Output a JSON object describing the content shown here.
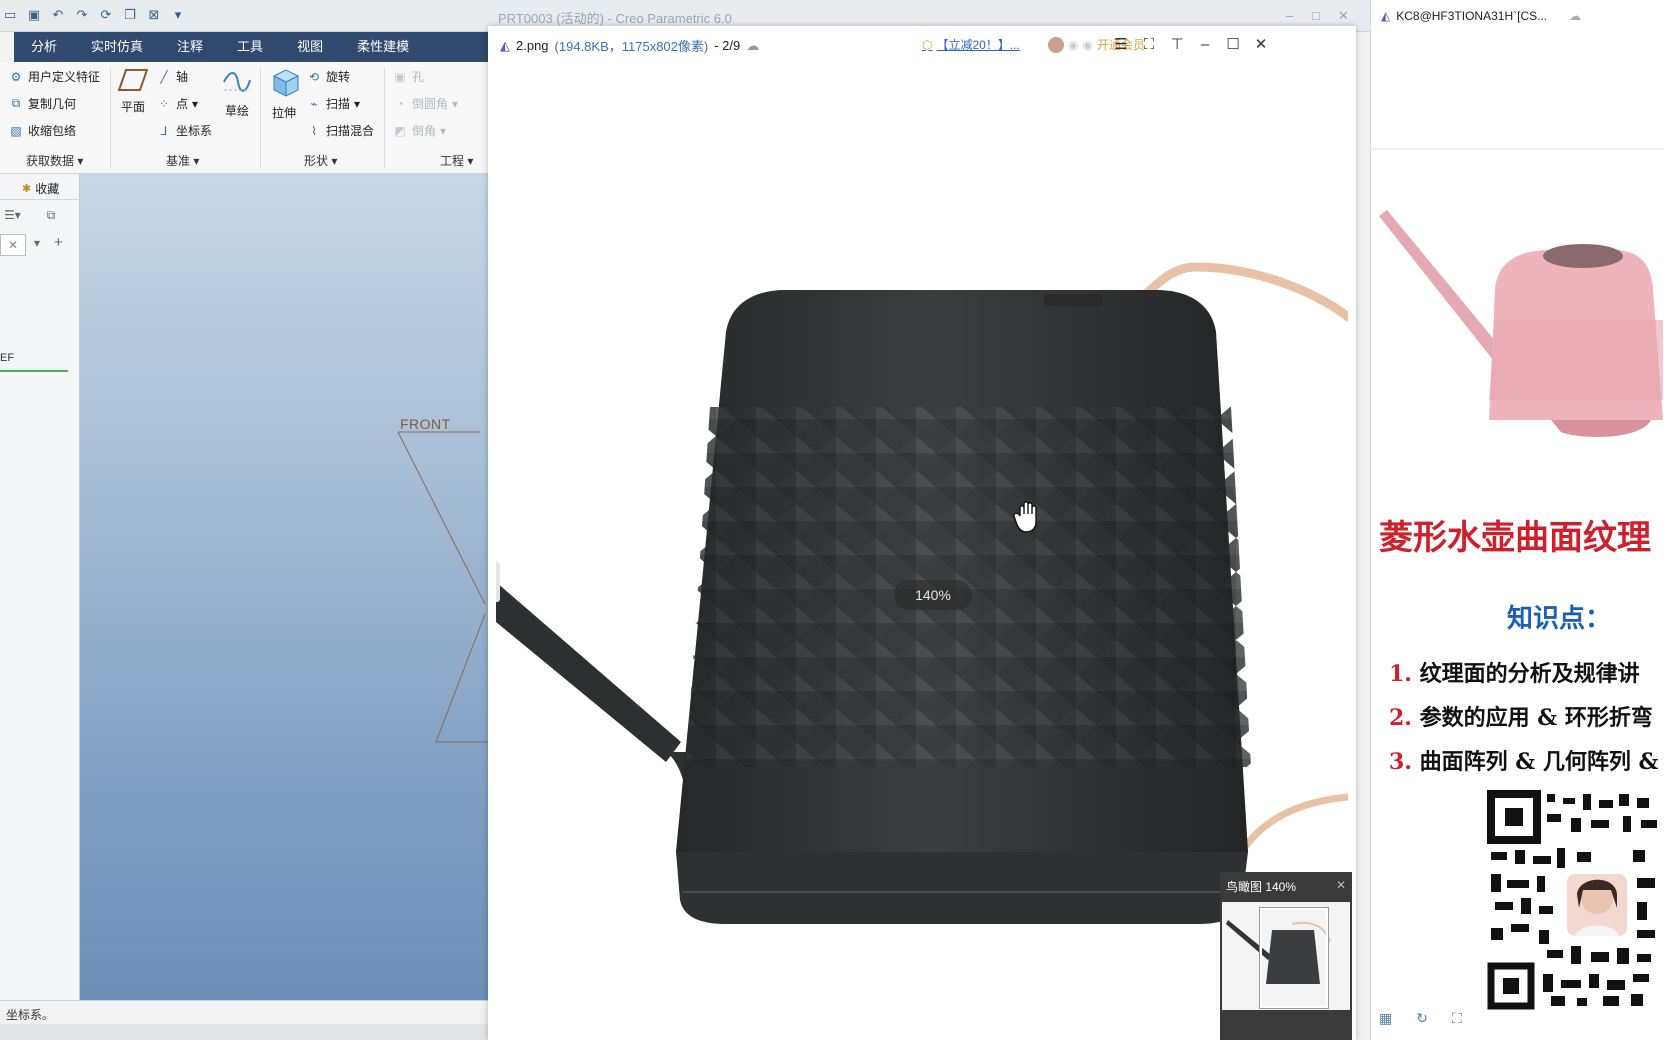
{
  "creo": {
    "title": "PRT0003 (活动的) - Creo Parametric 6.0",
    "menu_tabs": [
      "分析",
      "实时仿真",
      "注释",
      "工具",
      "视图",
      "柔性建模"
    ],
    "ribbon": {
      "get_data": {
        "items": [
          "用户定义特征",
          "复制几何",
          "收缩包络"
        ],
        "label": "获取数据"
      },
      "datum": {
        "plane": "平面",
        "axis": "轴",
        "point": "点",
        "csys": "坐标系",
        "sketch": "草绘",
        "label": "基准"
      },
      "shapes": {
        "extrude": "拉伸",
        "revolve": "旋转",
        "sweep": "扫描",
        "swept_blend": "扫描混合",
        "label": "形状"
      },
      "engineering": {
        "hole": "孔",
        "round": "倒圆角",
        "chamfer": "倒角",
        "label": "工程"
      }
    },
    "left_panel": {
      "favorites": "收藏",
      "tree_item": "EF"
    },
    "canvas_label": "FRONT",
    "status": "坐标系。"
  },
  "viewer": {
    "filename": "2.png",
    "meta": "(194.8KB，1175x802像素)",
    "index": "- 2/9",
    "promo": "【立减20！】...",
    "vip": "开通会员",
    "zoom_pill": "140%",
    "nav_pane_label": "鸟瞰图 140%",
    "product_color": "#3c3d3f",
    "handle_color": "#e8c2a6"
  },
  "right_app": {
    "title": "KC8@HF3TIONA31H`[CS...",
    "heading": "菱形水壶曲面纹理",
    "knowledge_label": "知识点：",
    "points": [
      {
        "num": "1.",
        "text": "纹理面的分析及规律讲"
      },
      {
        "num": "2.",
        "text": "参数的应用 & 环形折弯"
      },
      {
        "num": "3.",
        "text": "曲面阵列 & 几何阵列 &"
      }
    ],
    "accent": "#d01f2a",
    "blue": "#1b5fb4"
  }
}
